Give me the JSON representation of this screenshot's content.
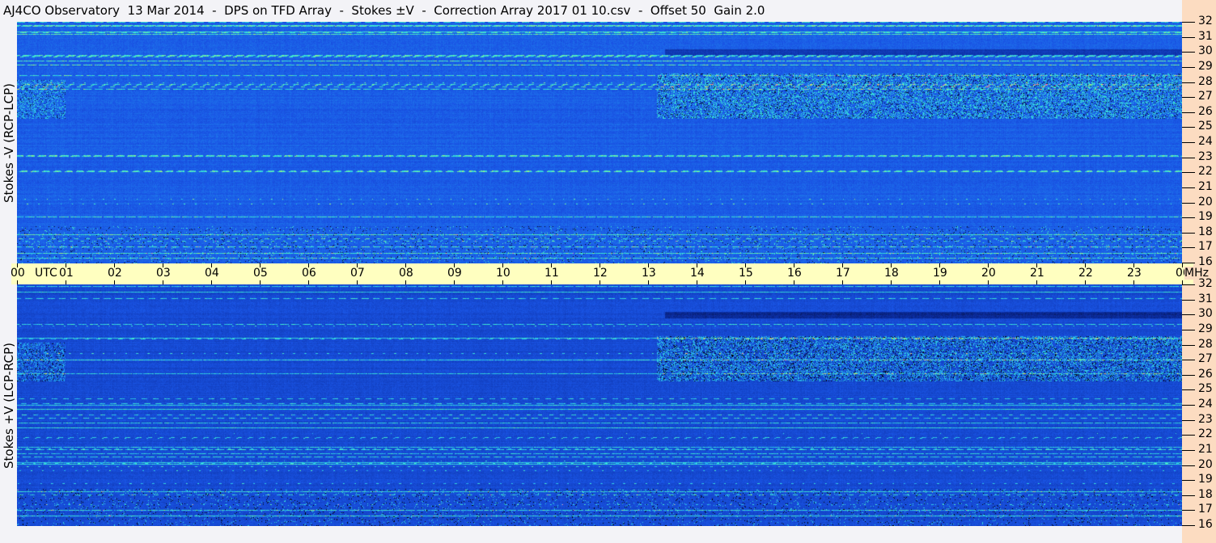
{
  "title": "AJ4CO Observatory  13 Mar 2014  -  DPS on TFD Array  -  Stokes ±V  -  Correction Array 2017 01 10.csv  -  Offset 50  Gain 2.0",
  "chart_data": [
    {
      "type": "heatmap",
      "panel_label": "Stokes -V (RCP-LCP)",
      "xlabel": "UTC",
      "ylabel": "MHz",
      "xlim": [
        0,
        24
      ],
      "ylim": [
        16,
        32
      ],
      "colormap": [
        "#000000",
        "#0a2a9a",
        "#1a55e6",
        "#23a8f0",
        "#3ef0d0",
        "#e8f040",
        "#ff60c0"
      ]
    },
    {
      "type": "heatmap",
      "panel_label": "Stokes +V (LCP-RCP)",
      "xlabel": "UTC",
      "ylabel": "MHz",
      "xlim": [
        0,
        24
      ],
      "ylim": [
        16,
        32
      ],
      "colormap": [
        "#000000",
        "#0a2a9a",
        "#1a55e6",
        "#23a8f0",
        "#3ef0d0",
        "#e8f040",
        "#ff60c0"
      ]
    }
  ],
  "x_ticks": [
    "00",
    "01",
    "02",
    "03",
    "04",
    "05",
    "06",
    "07",
    "08",
    "09",
    "10",
    "11",
    "12",
    "13",
    "14",
    "15",
    "16",
    "17",
    "18",
    "19",
    "20",
    "21",
    "22",
    "23",
    "00"
  ],
  "x_unit": "UTC",
  "y_unit": "MHz",
  "y_ticks": [
    "32",
    "31",
    "30",
    "29",
    "28",
    "27",
    "26",
    "25",
    "24",
    "23",
    "22",
    "21",
    "20",
    "19",
    "18",
    "17",
    "16"
  ],
  "colors": {
    "axis_band": "#ffffc0",
    "right_band": "#fcdcc1",
    "background": "#f3f3f7"
  }
}
